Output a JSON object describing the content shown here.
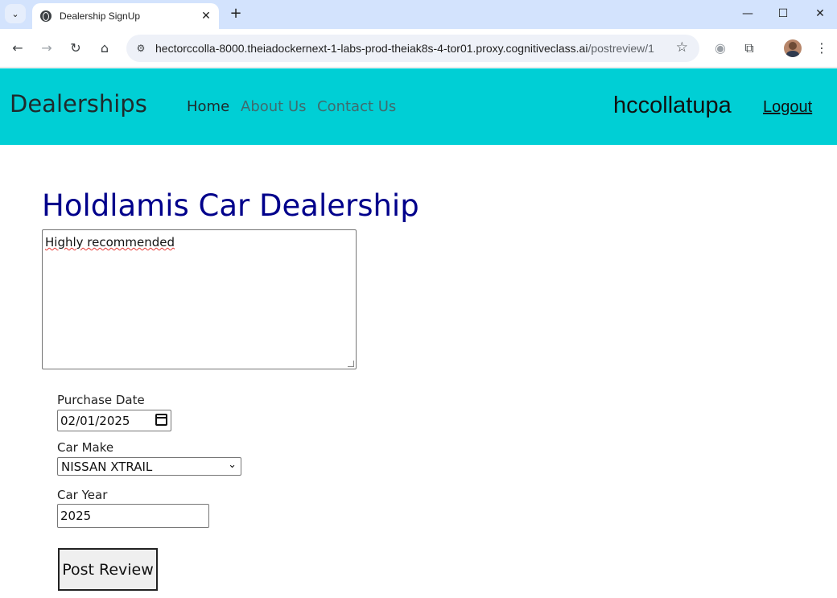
{
  "browser": {
    "tab_title": "Dealership SignUp",
    "tab_close": "✕",
    "new_tab": "+",
    "url_host": "hectorccolla-8000.theiadockernext-1-labs-prod-theiak8s-4-tor01.proxy.cognitiveclass.ai",
    "url_path": "/postreview/1",
    "icons": [
      "tab-search-icon",
      "globe-icon",
      "back-icon",
      "forward-icon",
      "reload-icon",
      "home-icon",
      "site-info-icon",
      "star-icon",
      "camera-icon",
      "extensions-icon",
      "menu-icon",
      "minimize-icon",
      "maximize-icon",
      "close-icon"
    ]
  },
  "navbar": {
    "brand": "Dealerships",
    "links": [
      {
        "label": "Home",
        "active": true
      },
      {
        "label": "About Us",
        "active": false
      },
      {
        "label": "Contact Us",
        "active": false
      }
    ],
    "username": "hccollatupa",
    "logout": "Logout",
    "background_color": "#00cfd5"
  },
  "main": {
    "dealer_name": "Holdlamis Car Dealership",
    "title_color": "#00008b",
    "review_text": "Highly recommended",
    "purchase_date_label": "Purchase Date",
    "purchase_date_value": "02/01/2025",
    "car_make_label": "Car Make",
    "car_make_value": "NISSAN XTRAIL",
    "car_year_label": "Car Year",
    "car_year_value": "2025",
    "post_button": "Post Review"
  }
}
